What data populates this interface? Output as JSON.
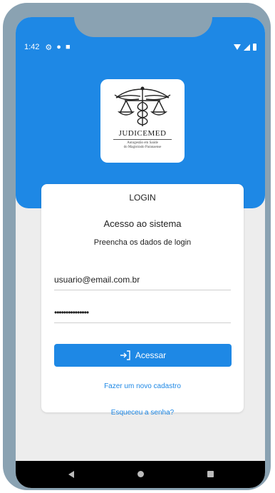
{
  "status_bar": {
    "time": "1:42"
  },
  "logo": {
    "name": "JUDICEMED",
    "subtitle_line1": "Autogestão em Saúde",
    "subtitle_line2": "do Magistrado Paranaense"
  },
  "card": {
    "title": "LOGIN",
    "heading": "Acesso ao sistema",
    "subtitle": "Preencha os dados de login",
    "email_value": "usuario@email.com.br",
    "password_value": "•••••••••••••••",
    "submit_label": "Acessar",
    "register_link": "Fazer um novo cadastro",
    "forgot_link": "Esqueceu a senha?"
  },
  "colors": {
    "primary": "#1e88e5",
    "frame": "#8aa2b2",
    "background": "#ededed"
  },
  "icons": {
    "login": "login-arrow-icon",
    "settings": "gear-icon",
    "wifi": "wifi-icon",
    "signal": "signal-icon",
    "battery": "battery-icon"
  }
}
